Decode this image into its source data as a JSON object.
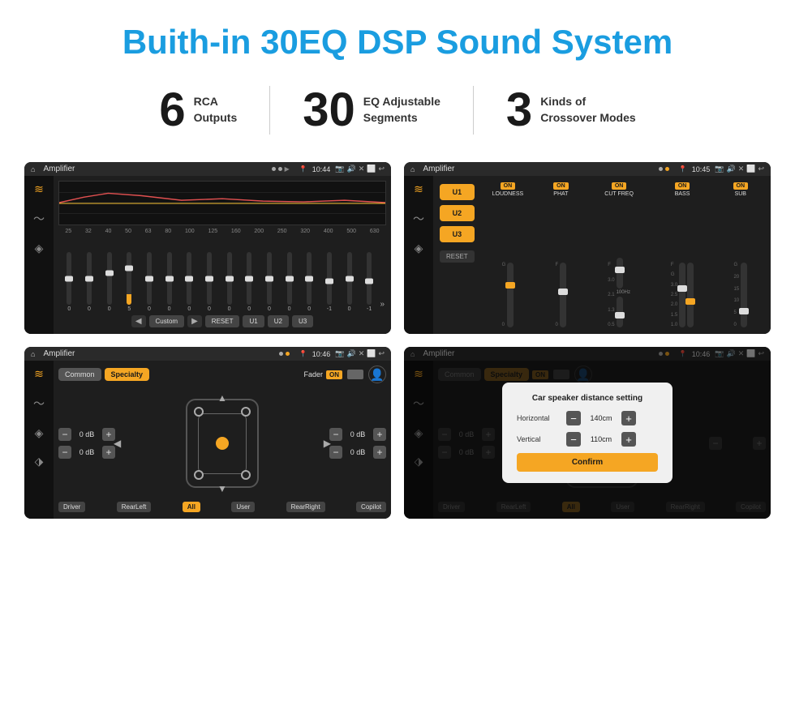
{
  "header": {
    "title": "Buith-in 30EQ DSP Sound System"
  },
  "stats": [
    {
      "number": "6",
      "label": "RCA\nOutputs"
    },
    {
      "number": "30",
      "label": "EQ Adjustable\nSegments"
    },
    {
      "number": "3",
      "label": "Kinds of\nCrossover Modes"
    }
  ],
  "screens": {
    "eq": {
      "title": "Amplifier",
      "time": "10:44",
      "freqs": [
        "25",
        "32",
        "40",
        "50",
        "63",
        "80",
        "100",
        "125",
        "160",
        "200",
        "250",
        "320",
        "400",
        "500",
        "630"
      ],
      "values": [
        "0",
        "0",
        "0",
        "5",
        "0",
        "0",
        "0",
        "0",
        "0",
        "0",
        "0",
        "0",
        "0",
        "-1",
        "0",
        "-1"
      ],
      "buttons": [
        "Custom",
        "RESET",
        "U1",
        "U2",
        "U3"
      ],
      "graph_label": "EQ Graph"
    },
    "crossover": {
      "title": "Amplifier",
      "time": "10:45",
      "presets": [
        "U1",
        "U2",
        "U3"
      ],
      "channels": [
        {
          "label": "LOUDNESS",
          "on": true
        },
        {
          "label": "PHAT",
          "on": true
        },
        {
          "label": "CUT FREQ",
          "on": true
        },
        {
          "label": "BASS",
          "on": true
        },
        {
          "label": "SUB",
          "on": true
        }
      ],
      "reset": "RESET"
    },
    "fader": {
      "title": "Amplifier",
      "time": "10:46",
      "tabs": [
        "Common",
        "Specialty"
      ],
      "fader_label": "Fader",
      "on_text": "ON",
      "db_values": [
        "0 dB",
        "0 dB",
        "0 dB",
        "0 dB"
      ],
      "bottom_labels": [
        "Driver",
        "RearLeft",
        "All",
        "User",
        "RearRight",
        "Copilot"
      ]
    },
    "dialog": {
      "title": "Amplifier",
      "time": "10:46",
      "tabs": [
        "Common",
        "Specialty"
      ],
      "on_text": "ON",
      "dialog_title": "Car speaker distance setting",
      "horizontal_label": "Horizontal",
      "horizontal_value": "140cm",
      "vertical_label": "Vertical",
      "vertical_value": "110cm",
      "confirm_btn": "Confirm",
      "db_values": [
        "0 dB",
        "0 dB"
      ],
      "bottom_labels": [
        "Driver",
        "RearLeft",
        "All",
        "User",
        "RearRight",
        "Copilot"
      ]
    }
  },
  "icons": {
    "home": "⌂",
    "back": "↩",
    "eq_icon": "≋",
    "wave_icon": "〜",
    "speaker_icon": "🔊",
    "person_icon": "👤",
    "location": "📍",
    "camera": "📷",
    "volume": "🔊",
    "close": "✕",
    "window": "⬜",
    "minus": "−",
    "plus": "+"
  }
}
